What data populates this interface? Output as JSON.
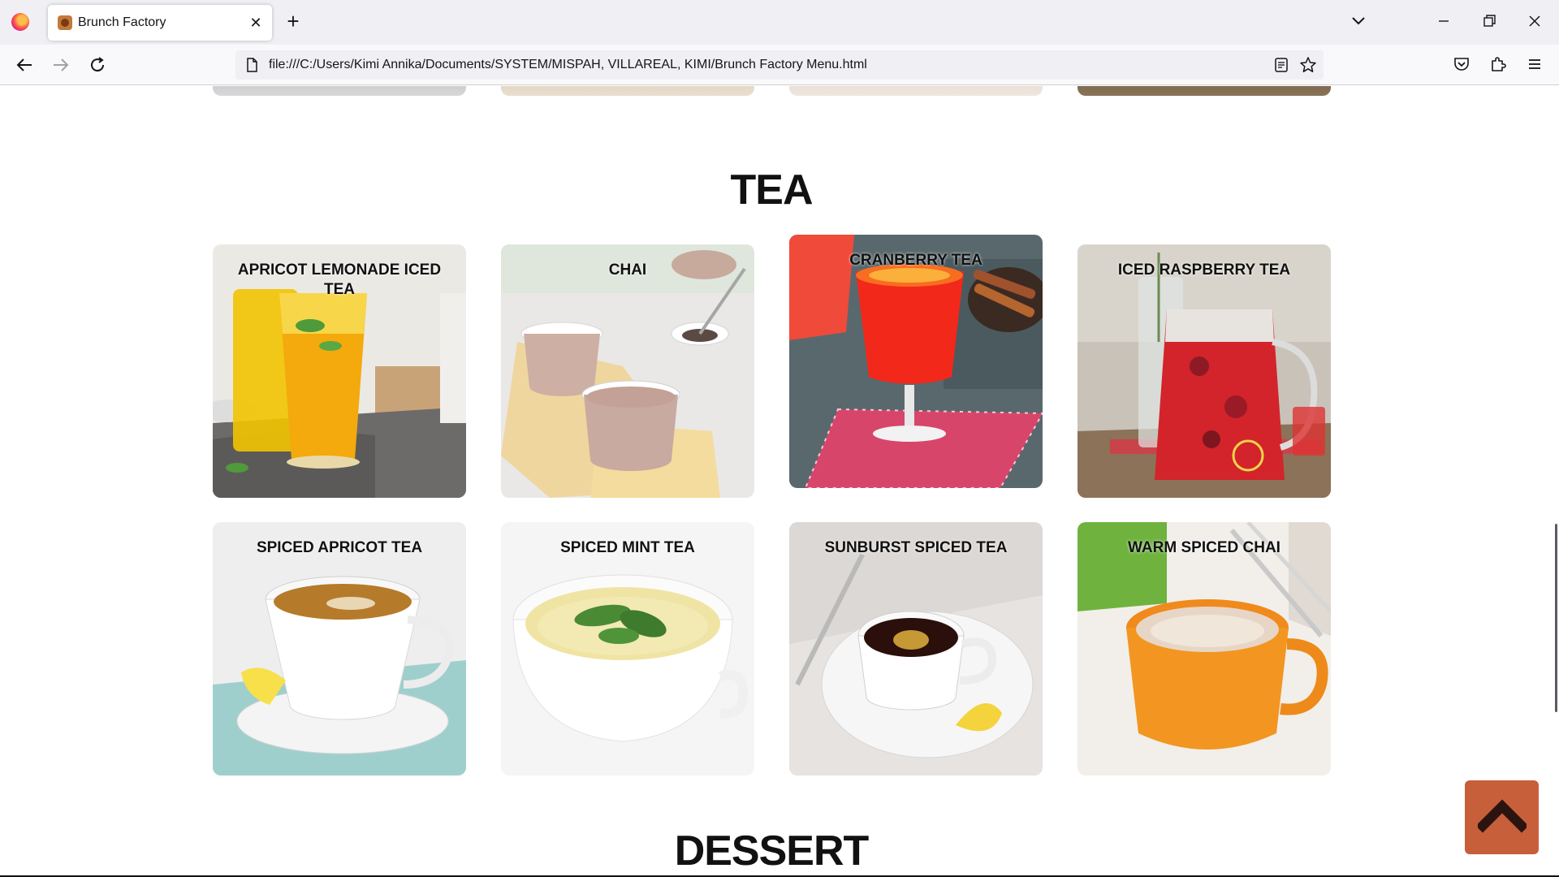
{
  "browser": {
    "tab_title": "Brunch Factory",
    "tab_close": "✕",
    "new_tab": "+",
    "url": "file:///C:/Users/Kimi Annika/Documents/SYSTEM/MISPAH, VILLAREAL, KIMI/Brunch Factory Menu.html",
    "icons": [
      "firefox-icon",
      "back-icon",
      "forward-icon",
      "reload-icon",
      "page-icon",
      "reader-view-icon",
      "bookmark-star-icon",
      "pocket-icon",
      "extensions-icon",
      "menu-icon",
      "list-tabs-icon",
      "minimize-icon",
      "restore-icon",
      "close-icon"
    ]
  },
  "sections": {
    "tea_title": "TEA",
    "dessert_title": "DESSERT"
  },
  "tea_items": [
    {
      "name": "APRICOT LEMONADE ICED TEA"
    },
    {
      "name": "CHAI"
    },
    {
      "name": "CRANBERRY TEA"
    },
    {
      "name": "ICED RASPBERRY TEA"
    },
    {
      "name": "SPICED APRICOT TEA"
    },
    {
      "name": "SPICED MINT TEA"
    },
    {
      "name": "SUNBURST SPICED TEA"
    },
    {
      "name": "WARM SPICED CHAI"
    }
  ],
  "scroll_top_button": {
    "icon": "chevron-up-icon",
    "color": "#c65f3a"
  }
}
